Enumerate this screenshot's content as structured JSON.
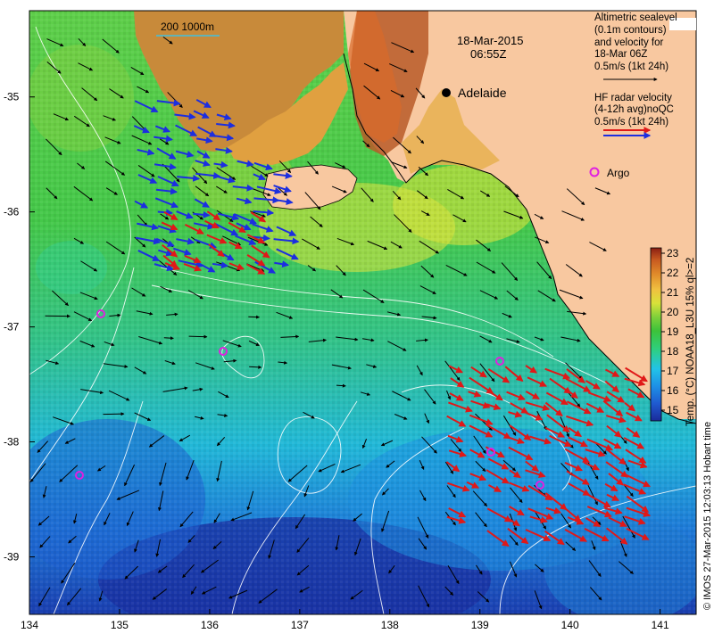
{
  "date_line": "18-Mar-2015",
  "time_line": "06:55Z",
  "scale_bar_label": "200  1000m",
  "place_label": "Adelaide",
  "legend": {
    "sealevel_lines": [
      "Altimetric sealevel",
      "(0.1m contours)",
      "and velocity for",
      "18-Mar 06Z",
      "0.5m/s (1kt 24h)"
    ],
    "radar_lines": [
      "HF radar velocity",
      "(4-12h avg)noQC",
      "0.5m/s (1kt 24h)"
    ],
    "argo_label": "Argo"
  },
  "colorbar": {
    "title": "Temp. (°C) NOAA18_L3U 15% ql>=2",
    "ticks": [
      "15",
      "16",
      "17",
      "18",
      "19",
      "20",
      "21",
      "22",
      "23"
    ],
    "colors": [
      "#1a2a9a",
      "#1f5ad0",
      "#1e90e6",
      "#22c3e8",
      "#2fcf7a",
      "#3cc23a",
      "#7fd03a",
      "#d8e23a",
      "#f0c040",
      "#e08a2a",
      "#c85a20",
      "#8a1e12"
    ]
  },
  "credit_text": "© IMOS 27-Mar-2015 12:03:13 Hobart time",
  "x_ticks": [
    "134",
    "135",
    "136",
    "137",
    "138",
    "139",
    "140",
    "141"
  ],
  "y_ticks": [
    "-35",
    "-36",
    "-37",
    "-38",
    "-39"
  ],
  "colors": {
    "land": "#f8c8a0",
    "radar_blue": "#1c2ee0",
    "radar_red": "#e01818",
    "argo": "#e020e0",
    "contour": "#ffffff",
    "scale_bar": "#40c0e0"
  }
}
